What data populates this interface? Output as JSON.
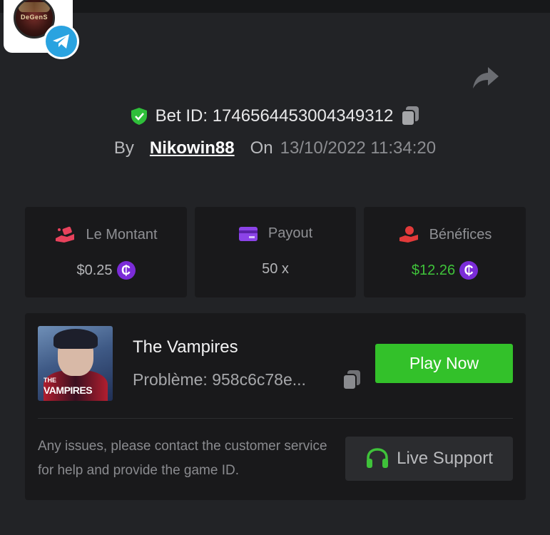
{
  "header": {
    "logo_text": "DeGenS",
    "icons": {
      "telegram": "telegram-icon",
      "share": "share-icon"
    }
  },
  "bet": {
    "id_label": "Bet ID: 1746564453004349312",
    "by_label": "By",
    "username": "Nikowin88",
    "on_label": "On",
    "datetime": "13/10/2022 11:34:20"
  },
  "stats": [
    {
      "label": "Le Montant",
      "value": "$0.25",
      "icon": "money-hand-icon",
      "value_color": "#b4b5b8"
    },
    {
      "label": "Payout",
      "value": "50 x",
      "icon": "card-icon",
      "value_color": "#b4b5b8"
    },
    {
      "label": "Bénéfices",
      "value": "$12.26",
      "icon": "profit-hand-icon",
      "value_color": "#3fc23a"
    }
  ],
  "coin_symbol": "₵",
  "game": {
    "thumb_line1": "THE",
    "thumb_line2": "VAMPIRES",
    "title": "The Vampires",
    "issue": "Problème: 958c6c78e...",
    "play_label": "Play Now"
  },
  "support": {
    "help_text": "Any issues, please contact the customer service for help and provide the game ID.",
    "button_label": "Live Support"
  },
  "colors": {
    "background": "#222326",
    "card": "#19191b",
    "accent_green": "#33c12a",
    "shield_green": "#2fbf3a",
    "coin_purple": "#7b2cd8"
  }
}
